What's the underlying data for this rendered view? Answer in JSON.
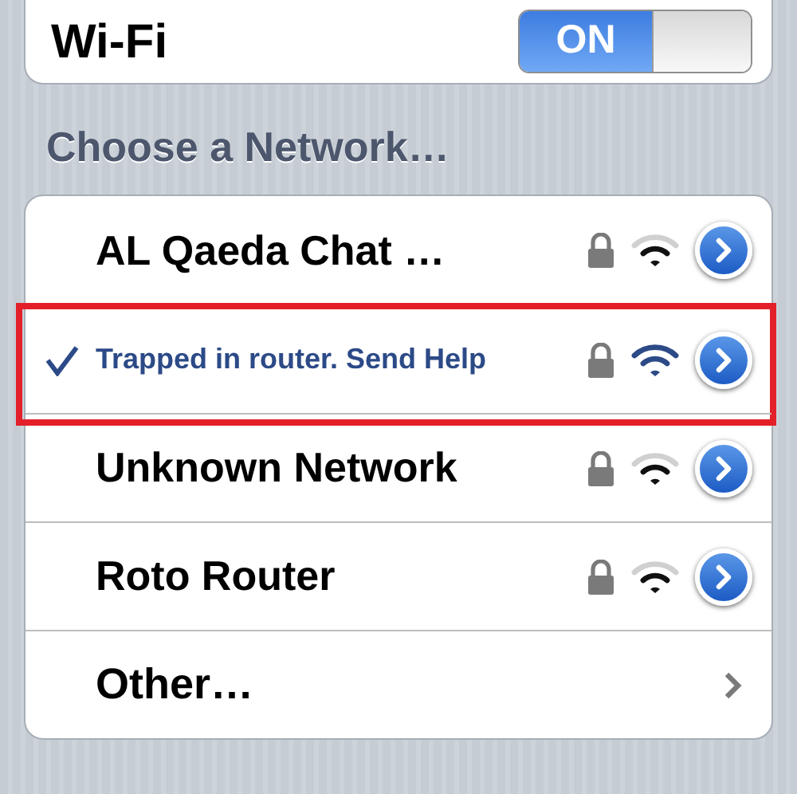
{
  "wifi": {
    "label": "Wi-Fi",
    "switch_text": "ON",
    "on": true
  },
  "section_title": "Choose a Network…",
  "networks": [
    {
      "kind": "network",
      "name": "AL Qaeda Chat …",
      "selected": false,
      "locked": true,
      "highlighted": false
    },
    {
      "kind": "network",
      "name": "Trapped in router. Send Help",
      "selected": true,
      "locked": true,
      "highlighted": true
    },
    {
      "kind": "network",
      "name": "Unknown Network",
      "selected": false,
      "locked": true,
      "highlighted": false
    },
    {
      "kind": "network",
      "name": "Roto Router",
      "selected": false,
      "locked": true,
      "highlighted": false
    },
    {
      "kind": "other",
      "name": "Other…"
    }
  ]
}
